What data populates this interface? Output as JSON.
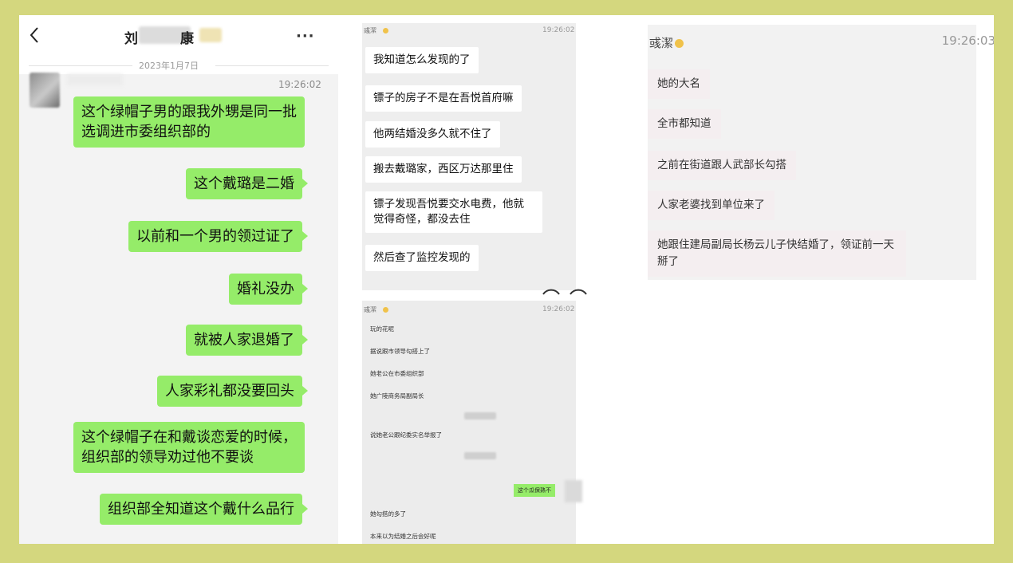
{
  "panel1": {
    "title_visible": "刘",
    "title_suffix": "康",
    "date": "2023年1月7日",
    "time": "19:26:02",
    "more_label": "···",
    "messages": [
      "这个绿帽子男的跟我外甥是同一批选调进市委组织部的",
      "这个戴璐是二婚",
      "以前和一个男的领过证了",
      "婚礼没办",
      "就被人家退婚了",
      "人家彩礼都没要回头",
      "这个绿帽子在和戴谈恋爱的时候，组织部的领导劝过他不要谈",
      "组织部全知道这个戴什么品行"
    ]
  },
  "panel2": {
    "sender": "彧潔",
    "time": "19:26:02",
    "messages": [
      "我知道怎么发现的了",
      "镖子的房子不是在吾悦首府嘛",
      "他两结婚没多久就不住了",
      "搬去戴璐家，西区万达那里住",
      "镖子发现吾悦要交水电费，他就觉得奇怪，都没去住",
      "然后查了监控发现的"
    ]
  },
  "panel3": {
    "sender": "彧潔",
    "time": "19:26:02",
    "messages": [
      "玩的花呢",
      "据说跟市领导勾搭上了",
      "她老公在市委组织部",
      "她广陵商务局副局长",
      "说她老公跟纪委实名举报了",
      "这个瓜保熟不",
      "她勾搭的多了",
      "本来以为结婚之后会好呢"
    ]
  },
  "panel4": {
    "sender": "彧潔",
    "time": "19:26:03",
    "messages": [
      "她的大名",
      "全市都知道",
      "之前在街道跟人武部长勾搭",
      "人家老婆找到单位来了",
      "她跟住建局副局长杨云儿子快结婚了，领证前一天掰了"
    ]
  },
  "colors": {
    "outer_bg": "#d4d77e",
    "green_bubble": "#95ec69",
    "white_bubble": "#ffffff"
  }
}
